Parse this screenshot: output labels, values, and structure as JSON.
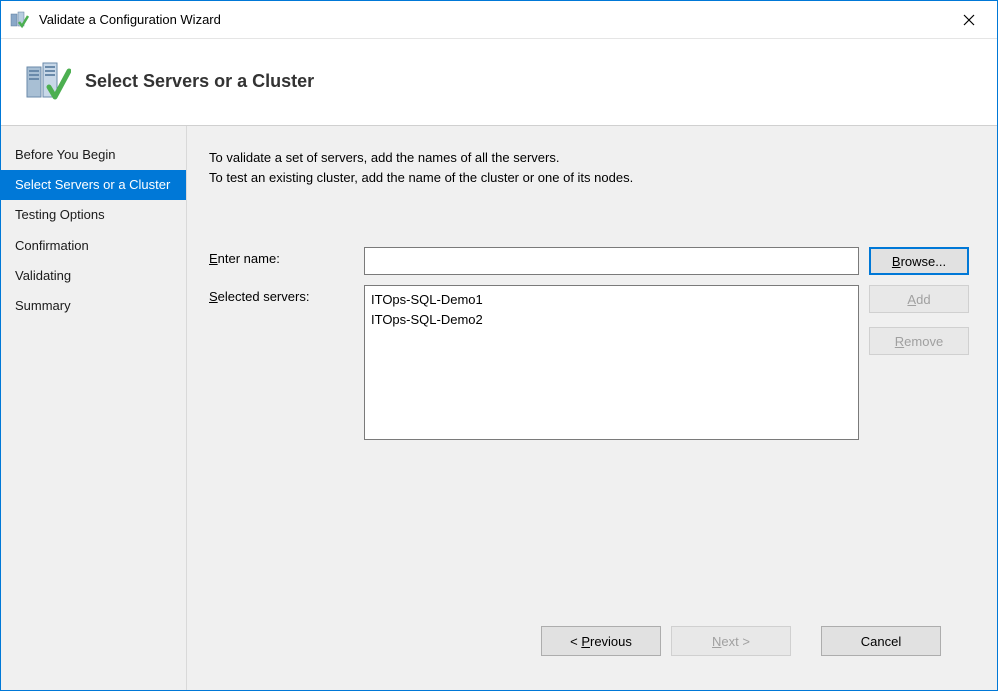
{
  "window": {
    "title": "Validate a Configuration Wizard"
  },
  "header": {
    "title": "Select Servers or a Cluster"
  },
  "sidebar": {
    "items": [
      {
        "label": "Before You Begin"
      },
      {
        "label": "Select Servers or a Cluster"
      },
      {
        "label": "Testing Options"
      },
      {
        "label": "Confirmation"
      },
      {
        "label": "Validating"
      },
      {
        "label": "Summary"
      }
    ]
  },
  "main": {
    "instructions_line1": "To validate a set of servers, add the names of all the servers.",
    "instructions_line2": "To test an existing cluster, add the name of the cluster or one of its nodes.",
    "enter_name_label_pre": "E",
    "enter_name_label_rest": "nter name:",
    "selected_servers_label_pre": "S",
    "selected_servers_label_rest": "elected servers:",
    "name_value": "",
    "selected_servers": [
      "ITOps-SQL-Demo1",
      "ITOps-SQL-Demo2"
    ]
  },
  "buttons": {
    "browse_pre": "B",
    "browse_rest": "rowse...",
    "add_pre": "A",
    "add_rest": "dd",
    "remove_pre": "R",
    "remove_rest": "emove",
    "previous_pre": "< ",
    "previous_u": "P",
    "previous_rest": "revious",
    "next_pre": "",
    "next_u": "N",
    "next_rest": "ext >",
    "cancel": "Cancel"
  }
}
